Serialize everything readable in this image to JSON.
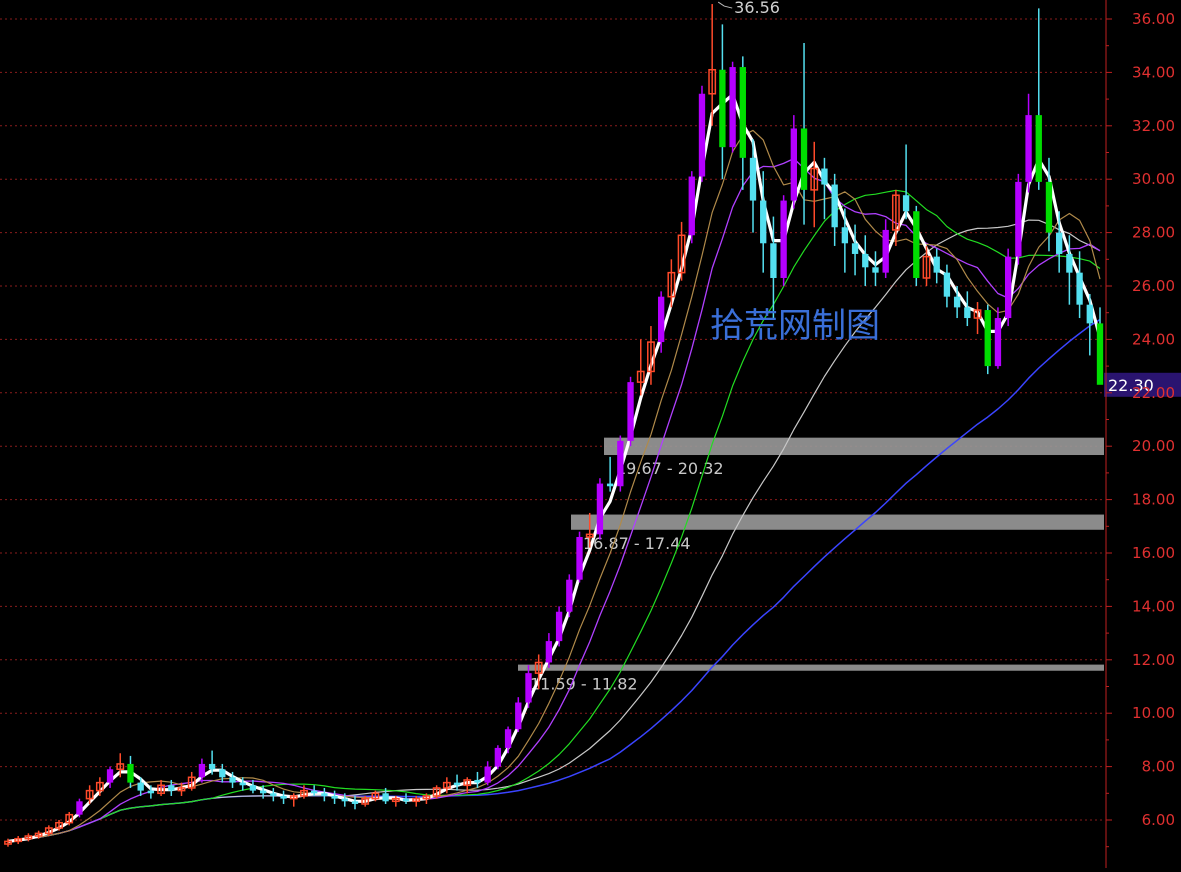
{
  "chart_data": {
    "type": "candlestick",
    "y_axis": {
      "side": "right",
      "ylim": [
        4.5,
        37.2
      ],
      "ticks": [
        6.0,
        8.0,
        10.0,
        12.0,
        14.0,
        16.0,
        18.0,
        20.0,
        22.0,
        24.0,
        26.0,
        28.0,
        30.0,
        32.0,
        34.0,
        36.0
      ],
      "tick_labels": [
        "6.00",
        "8.00",
        "10.00",
        "12.00",
        "14.00",
        "16.00",
        "18.00",
        "20.00",
        "22.00",
        "24.00",
        "26.00",
        "28.00",
        "30.00",
        "32.00",
        "34.00",
        "36.00"
      ],
      "grid": true
    },
    "current_price": {
      "value": 22.3,
      "label": "22.30"
    },
    "high_marker": {
      "value": 36.56,
      "label": "36.56"
    },
    "watermark": "拾荒网制图",
    "zones": [
      {
        "low": 19.67,
        "high": 20.32,
        "label": "19.67 - 20.32"
      },
      {
        "low": 16.87,
        "high": 17.44,
        "label": "16.87 - 17.44"
      },
      {
        "low": 11.59,
        "high": 11.82,
        "label": "11.59 - 11.82"
      }
    ],
    "candles": [
      [
        5.1,
        5.3,
        5.0,
        5.2
      ],
      [
        5.2,
        5.4,
        5.1,
        5.3
      ],
      [
        5.3,
        5.5,
        5.2,
        5.4
      ],
      [
        5.4,
        5.6,
        5.3,
        5.5
      ],
      [
        5.5,
        5.8,
        5.4,
        5.7
      ],
      [
        5.7,
        6.0,
        5.6,
        5.9
      ],
      [
        5.9,
        6.3,
        5.8,
        6.2
      ],
      [
        6.2,
        6.8,
        6.1,
        6.7
      ],
      [
        6.8,
        7.3,
        6.6,
        7.1
      ],
      [
        7.1,
        7.6,
        6.9,
        7.4
      ],
      [
        7.4,
        8.0,
        7.2,
        7.9
      ],
      [
        7.9,
        8.5,
        7.6,
        8.1
      ],
      [
        8.1,
        8.4,
        7.2,
        7.4
      ],
      [
        7.4,
        7.6,
        6.9,
        7.1
      ],
      [
        7.1,
        7.3,
        6.8,
        7.0
      ],
      [
        7.0,
        7.5,
        6.9,
        7.3
      ],
      [
        7.3,
        7.5,
        6.9,
        7.1
      ],
      [
        7.1,
        7.4,
        6.9,
        7.2
      ],
      [
        7.2,
        7.8,
        7.1,
        7.6
      ],
      [
        7.6,
        8.3,
        7.4,
        8.1
      ],
      [
        8.1,
        8.6,
        7.7,
        7.9
      ],
      [
        7.9,
        8.1,
        7.4,
        7.6
      ],
      [
        7.6,
        7.8,
        7.2,
        7.4
      ],
      [
        7.4,
        7.6,
        7.1,
        7.3
      ],
      [
        7.3,
        7.5,
        7.0,
        7.1
      ],
      [
        7.1,
        7.3,
        6.8,
        7.0
      ],
      [
        7.0,
        7.2,
        6.7,
        6.9
      ],
      [
        6.9,
        7.1,
        6.6,
        6.8
      ],
      [
        6.8,
        7.0,
        6.5,
        6.9
      ],
      [
        6.9,
        7.3,
        6.8,
        7.1
      ],
      [
        7.1,
        7.3,
        6.9,
        7.0
      ],
      [
        7.0,
        7.2,
        6.7,
        6.9
      ],
      [
        6.9,
        7.1,
        6.6,
        6.8
      ],
      [
        6.8,
        7.0,
        6.5,
        6.7
      ],
      [
        6.7,
        6.9,
        6.4,
        6.6
      ],
      [
        6.6,
        6.9,
        6.5,
        6.8
      ],
      [
        6.8,
        7.1,
        6.7,
        7.0
      ],
      [
        7.0,
        7.2,
        6.6,
        6.7
      ],
      [
        6.7,
        6.9,
        6.5,
        6.8
      ],
      [
        6.8,
        7.0,
        6.6,
        6.7
      ],
      [
        6.7,
        6.9,
        6.5,
        6.8
      ],
      [
        6.8,
        7.0,
        6.6,
        6.9
      ],
      [
        6.9,
        7.3,
        6.8,
        7.2
      ],
      [
        7.2,
        7.6,
        7.0,
        7.4
      ],
      [
        7.4,
        7.7,
        7.1,
        7.3
      ],
      [
        7.3,
        7.6,
        7.0,
        7.5
      ],
      [
        7.5,
        7.8,
        7.2,
        7.4
      ],
      [
        7.4,
        8.2,
        7.3,
        8.0
      ],
      [
        8.0,
        8.8,
        7.9,
        8.7
      ],
      [
        8.7,
        9.5,
        8.5,
        9.4
      ],
      [
        9.4,
        10.6,
        9.3,
        10.4
      ],
      [
        10.4,
        11.8,
        10.2,
        11.5
      ],
      [
        11.5,
        12.2,
        10.9,
        11.9
      ],
      [
        11.9,
        13.0,
        11.7,
        12.7
      ],
      [
        12.7,
        14.0,
        12.5,
        13.8
      ],
      [
        13.8,
        15.2,
        13.6,
        15.0
      ],
      [
        15.0,
        16.8,
        14.9,
        16.6
      ],
      [
        16.6,
        17.5,
        16.2,
        16.7
      ],
      [
        16.7,
        18.8,
        16.5,
        18.6
      ],
      [
        18.6,
        19.6,
        18.3,
        18.5
      ],
      [
        18.5,
        20.4,
        18.3,
        20.2
      ],
      [
        20.2,
        22.6,
        20.0,
        22.4
      ],
      [
        22.4,
        24.0,
        21.9,
        22.8
      ],
      [
        22.8,
        24.5,
        22.3,
        23.9
      ],
      [
        23.9,
        25.8,
        23.5,
        25.6
      ],
      [
        25.6,
        27.0,
        25.2,
        26.5
      ],
      [
        26.5,
        28.4,
        26.2,
        27.9
      ],
      [
        27.9,
        30.3,
        27.6,
        30.1
      ],
      [
        30.1,
        33.5,
        29.9,
        33.2
      ],
      [
        33.2,
        36.56,
        32.0,
        34.1
      ],
      [
        34.1,
        35.8,
        30.0,
        31.2
      ],
      [
        31.2,
        34.4,
        31.0,
        34.2
      ],
      [
        34.2,
        34.6,
        29.6,
        30.8
      ],
      [
        30.8,
        31.5,
        28.0,
        29.2
      ],
      [
        29.2,
        30.3,
        26.5,
        27.6
      ],
      [
        27.6,
        28.6,
        24.8,
        26.3
      ],
      [
        26.3,
        29.4,
        26.0,
        29.2
      ],
      [
        29.2,
        32.4,
        28.9,
        31.9
      ],
      [
        31.9,
        35.1,
        28.3,
        29.6
      ],
      [
        29.6,
        31.4,
        28.2,
        30.4
      ],
      [
        30.4,
        30.8,
        28.5,
        29.8
      ],
      [
        29.8,
        30.2,
        27.5,
        28.2
      ],
      [
        28.2,
        28.9,
        26.5,
        27.6
      ],
      [
        27.6,
        28.3,
        26.4,
        27.2
      ],
      [
        27.2,
        27.9,
        26.0,
        26.7
      ],
      [
        26.7,
        27.3,
        26.0,
        26.5
      ],
      [
        26.5,
        28.5,
        26.3,
        28.1
      ],
      [
        28.1,
        29.6,
        27.5,
        29.4
      ],
      [
        29.4,
        31.3,
        28.5,
        28.8
      ],
      [
        28.8,
        29.0,
        26.0,
        26.3
      ],
      [
        26.3,
        27.5,
        26.0,
        27.1
      ],
      [
        27.1,
        27.4,
        26.1,
        26.5
      ],
      [
        26.5,
        26.8,
        25.2,
        25.6
      ],
      [
        25.6,
        26.0,
        24.8,
        25.2
      ],
      [
        25.2,
        25.8,
        24.5,
        24.8
      ],
      [
        24.8,
        25.4,
        24.2,
        25.1
      ],
      [
        25.1,
        25.3,
        22.7,
        23.0
      ],
      [
        23.0,
        25.2,
        22.9,
        24.8
      ],
      [
        24.8,
        27.4,
        24.5,
        27.1
      ],
      [
        27.1,
        30.2,
        26.8,
        29.9
      ],
      [
        29.9,
        33.2,
        29.5,
        32.4
      ],
      [
        32.4,
        36.4,
        29.6,
        29.9
      ],
      [
        29.9,
        30.8,
        27.3,
        28.0
      ],
      [
        28.0,
        28.8,
        26.5,
        27.2
      ],
      [
        27.2,
        27.9,
        25.3,
        26.5
      ],
      [
        26.5,
        27.3,
        24.8,
        25.3
      ],
      [
        25.3,
        25.7,
        23.4,
        24.6
      ],
      [
        24.6,
        25.2,
        22.5,
        22.3
      ]
    ]
  }
}
